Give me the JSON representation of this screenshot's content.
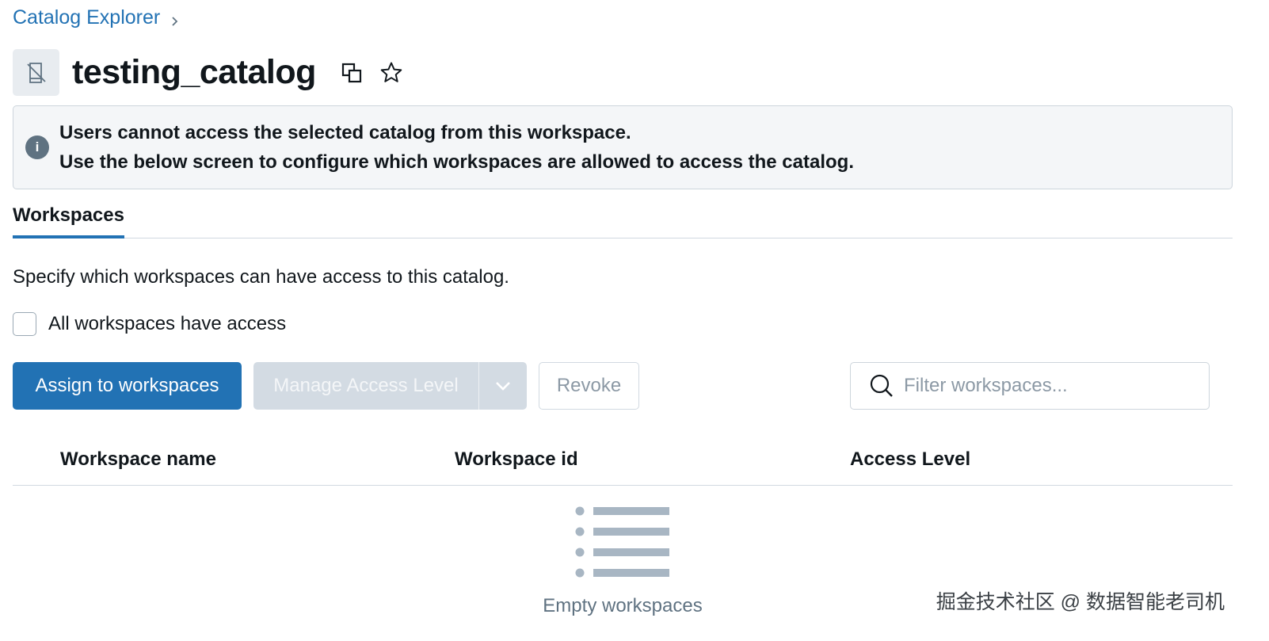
{
  "breadcrumb": {
    "root": "Catalog Explorer"
  },
  "header": {
    "title": "testing_catalog",
    "icons": [
      "catalog-icon",
      "copy-icon",
      "star-icon"
    ]
  },
  "alert": {
    "line1": "Users cannot access the selected catalog from this workspace.",
    "line2": "Use the below screen to configure which workspaces are allowed to access the catalog."
  },
  "tabs": [
    {
      "label": "Workspaces",
      "active": true
    }
  ],
  "workspaces": {
    "description": "Specify which workspaces can have access to this catalog.",
    "all_access_label": "All workspaces have access",
    "all_access_checked": false,
    "assign_label": "Assign to workspaces",
    "manage_label": "Manage Access Level",
    "revoke_label": "Revoke",
    "filter_placeholder": "Filter workspaces...",
    "columns": [
      "Workspace name",
      "Workspace id",
      "Access Level"
    ],
    "rows": [],
    "empty_label": "Empty workspaces"
  },
  "watermark": "掘金技术社区 @ 数据智能老司机",
  "colors": {
    "primary": "#2272b4",
    "disabled_button": "#d3dbe3",
    "alert_bg": "#f4f6f8",
    "text": "#11171c",
    "muted": "#5f7281"
  }
}
